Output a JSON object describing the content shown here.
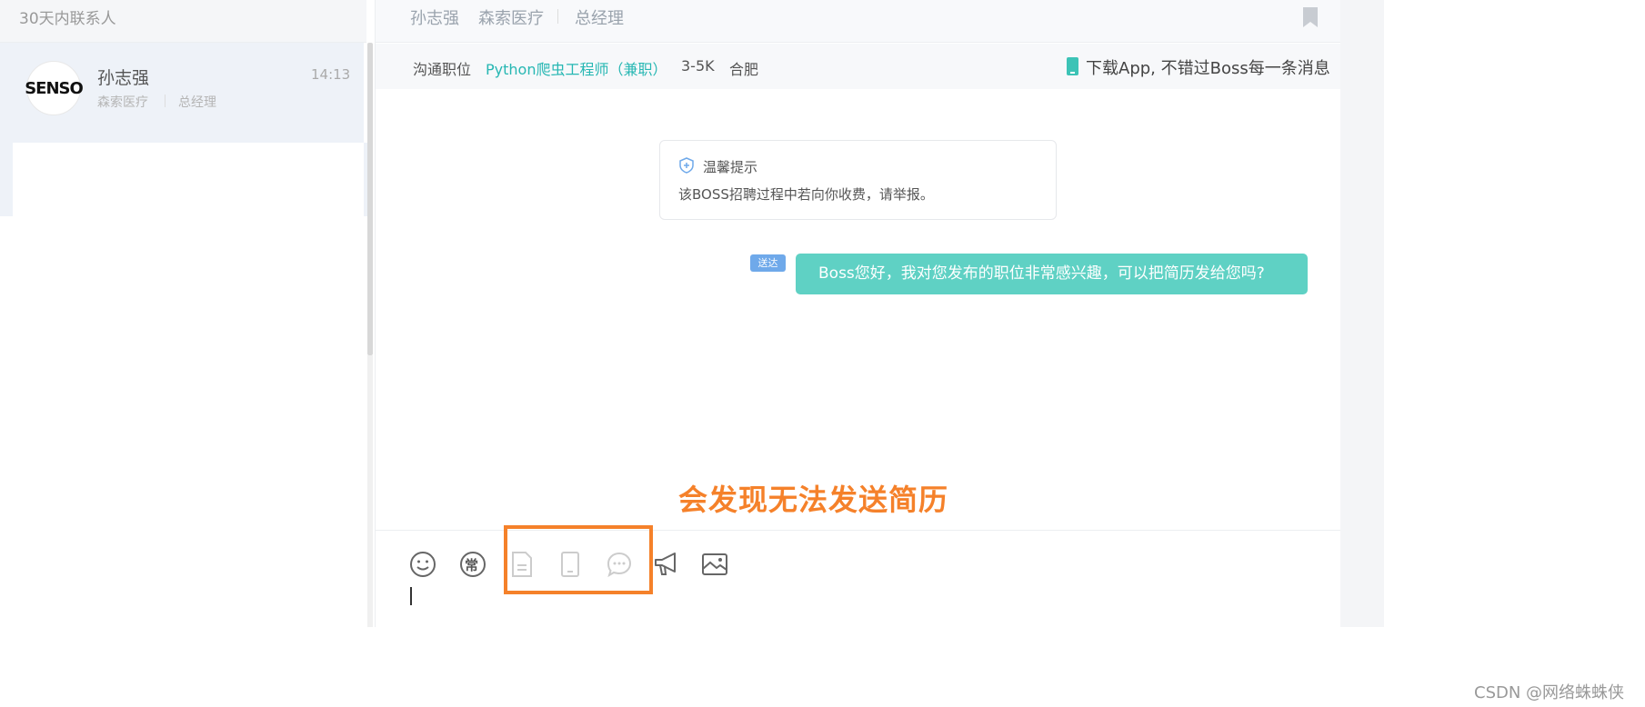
{
  "contacts_panel": {
    "title": "30天内联系人",
    "contact": {
      "avatar_text": "SENSO",
      "name": "孙志强",
      "time": "14:13",
      "company": "森索医疗",
      "role": "总经理"
    }
  },
  "chat_header": {
    "name": "孙志强",
    "company": "森索医疗",
    "role": "总经理",
    "bookmark_icon": "bookmark-icon"
  },
  "job_bar": {
    "label": "沟通职位",
    "title": "Python爬虫工程师（兼职）",
    "salary": "3-5K",
    "city": "合肥",
    "app_prompt": "下载App, 不错过Boss每一条消息"
  },
  "tip": {
    "title": "温馨提示",
    "text": "该BOSS招聘过程中若向你收费，请举报。"
  },
  "message": {
    "status": "送达",
    "text": "Boss您好，我对您发布的职位非常感兴趣，可以把简历发给您吗?"
  },
  "annotation": "会发现无法发送简历",
  "toolbar": {
    "emoji": "emoji-icon",
    "common_phrases": "常",
    "resume": "resume-icon",
    "phone": "phone-icon",
    "wechat": "wechat-icon",
    "notice": "megaphone-icon",
    "image": "image-icon"
  },
  "watermark": "CSDN @网络蛛蛛侠",
  "colors": {
    "accent": "#27b7b3",
    "bubble": "#5fd1c4",
    "badge": "#6fa9ea",
    "annotation": "#f5812a"
  }
}
